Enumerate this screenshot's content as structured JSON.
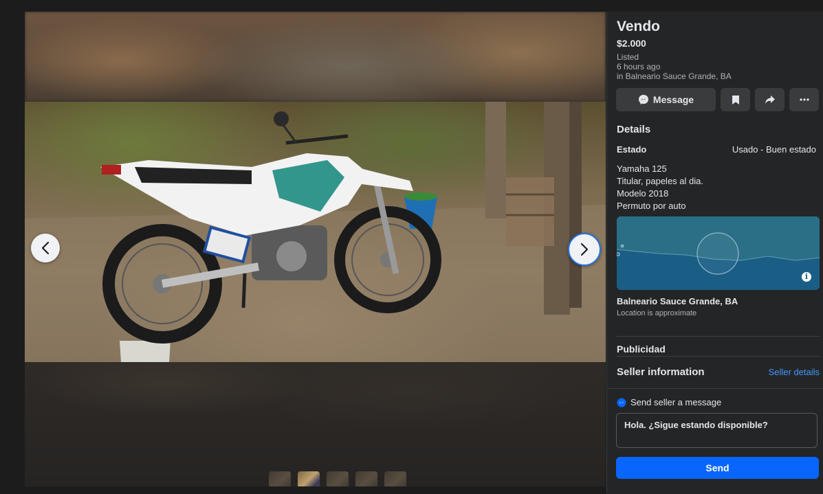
{
  "listing": {
    "title": "Vendo",
    "price": "$2.000",
    "listed_label": "Listed",
    "listed_ago": "6 hours ago",
    "listed_location": "in Balneario Sauce Grande, BA"
  },
  "actions": {
    "message_label": "Message",
    "save_icon": "bookmark-icon",
    "share_icon": "share-icon",
    "more_icon": "more-icon"
  },
  "details": {
    "heading": "Details",
    "condition_key": "Estado",
    "condition_value": "Usado - Buen estado",
    "description": [
      "Yamaha 125",
      "Titular, papeles al dia.",
      "Modelo 2018",
      "Permuto por auto"
    ]
  },
  "location": {
    "city": "Balneario Sauce Grande, BA",
    "note": "Location is approximate",
    "info_glyph": "i"
  },
  "sections": {
    "ads": "Publicidad",
    "seller_heading": "Seller information",
    "seller_link": "Seller details"
  },
  "composer": {
    "heading": "Send seller a message",
    "message": "Hola. ¿Sigue estando disponible?",
    "send_label": "Send"
  },
  "gallery": {
    "thumbnail_count": 5,
    "active_index": 1
  },
  "colors": {
    "accent": "#0866ff",
    "link": "#4599ff",
    "panel_bg": "#242526",
    "page_bg": "#1c1c1d"
  }
}
